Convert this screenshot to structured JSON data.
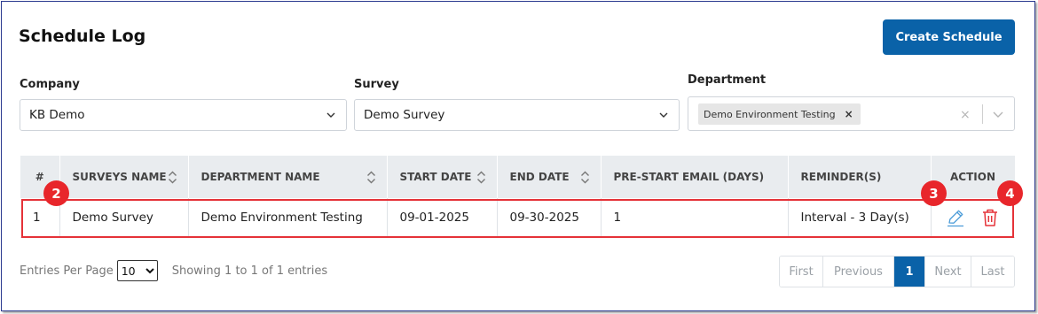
{
  "page": {
    "title": "Schedule Log",
    "create_button": "Create Schedule"
  },
  "filters": {
    "company": {
      "label": "Company",
      "value": "KB Demo"
    },
    "survey": {
      "label": "Survey",
      "value": "Demo Survey"
    },
    "department": {
      "label": "Department",
      "tag": "Demo Environment Testing",
      "tag_remove": "×",
      "clear": "×"
    }
  },
  "table": {
    "headers": [
      "#",
      "SURVEYS NAME",
      "DEPARTMENT NAME",
      "START DATE",
      "END DATE",
      "PRE-START EMAIL (DAYS)",
      "REMINDER(S)",
      "ACTION"
    ],
    "rows": [
      {
        "num": "1",
        "survey": "Demo Survey",
        "department": "Demo Environment Testing",
        "start": "09-01-2025",
        "end": "09-30-2025",
        "prestart": "1",
        "reminder": "Interval - 3 Day(s)"
      }
    ],
    "action_icons": [
      "edit-icon",
      "trash-icon"
    ]
  },
  "annotations": [
    "2",
    "3",
    "4"
  ],
  "footer": {
    "entries_label": "Entries Per Page",
    "entries_value": "10",
    "showing": "Showing 1 to 1 of 1 entries",
    "pager": {
      "first": "First",
      "previous": "Previous",
      "current": "1",
      "next": "Next",
      "last": "Last"
    }
  },
  "colors": {
    "primary": "#0a62a8",
    "annotation": "#e8262b",
    "delete": "#e53238",
    "edit": "#4a9bd8"
  }
}
